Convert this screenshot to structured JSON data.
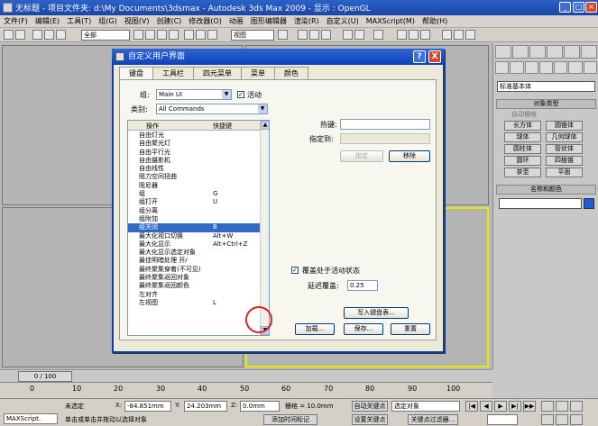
{
  "window": {
    "title": "无标题        - 项目文件夹: d:\\My Documents\\3dsmax        - Autodesk 3ds Max  2009        - 显示 : OpenGL"
  },
  "menu": [
    "文件(F)",
    "编辑(E)",
    "工具(T)",
    "组(G)",
    "视图(V)",
    "创建(C)",
    "修改器(O)",
    "动画",
    "图形编辑器",
    "渲染(R)",
    "自定义(U)",
    "MAXScript(M)",
    "帮助(H)"
  ],
  "toolbar": {
    "selection_set": "全部",
    "view_dropdown": "视图"
  },
  "dialog": {
    "title": "自定义用户界面",
    "help": "?",
    "close": "X",
    "tabs": [
      "键盘",
      "工具栏",
      "四元菜单",
      "菜单",
      "颜色"
    ],
    "group_label": "组:",
    "group_value": "Main UI",
    "active_label": "活动",
    "category_label": "类别:",
    "category_value": "All Commands",
    "col_action": "操作",
    "col_shortcut": "快捷键",
    "actions": [
      {
        "name": "自由灯光",
        "shortcut": ""
      },
      {
        "name": "自由聚光灯",
        "shortcut": ""
      },
      {
        "name": "自由平行光",
        "shortcut": ""
      },
      {
        "name": "自由摄影机",
        "shortcut": ""
      },
      {
        "name": "自由线性",
        "shortcut": ""
      },
      {
        "name": "阻力空间扭曲",
        "shortcut": ""
      },
      {
        "name": "阻尼器",
        "shortcut": ""
      },
      {
        "name": "组",
        "shortcut": "G"
      },
      {
        "name": "组打开",
        "shortcut": "U"
      },
      {
        "name": "组分离",
        "shortcut": ""
      },
      {
        "name": "组附加",
        "shortcut": ""
      },
      {
        "name": "组关闭",
        "shortcut": "B"
      },
      {
        "name": "最大化视口切换",
        "shortcut": "Alt+W"
      },
      {
        "name": "最大化显示",
        "shortcut": "Alt+Ctrl+Z"
      },
      {
        "name": "最大化显示选定对象",
        "shortcut": ""
      },
      {
        "name": "最佳明暗处理 开/",
        "shortcut": ""
      },
      {
        "name": "最终聚集穿着(不可见)",
        "shortcut": ""
      },
      {
        "name": "最终聚集返回对象",
        "shortcut": ""
      },
      {
        "name": "最终聚集返回颜色",
        "shortcut": ""
      },
      {
        "name": "左对齐",
        "shortcut": ""
      },
      {
        "name": "左视图",
        "shortcut": "L"
      }
    ],
    "selected_index": 11,
    "hotkey_label": "热键:",
    "assigned_label": "指定到:",
    "assign_button": "指定",
    "remove_button": "移除",
    "overlay_label": "覆盖处于活动状态",
    "delay_label": "延迟覆盖:",
    "delay_value": "0.25",
    "write_button": "写入键盘表...",
    "load_button": "加载...",
    "save_button": "保存...",
    "reset_button": "重置"
  },
  "command_panel": {
    "dropdown": "标准基本体",
    "rollout_type": "对象类型",
    "autogrid": "自动栅格",
    "objects": [
      "长方体",
      "圆锥体",
      "球体",
      "几何球体",
      "圆柱体",
      "管状体",
      "圆环",
      "四棱锥",
      "茶壶",
      "平面"
    ],
    "rollout_name": "名称和颜色",
    "object_color": "#1c5cd8"
  },
  "timeline": {
    "slider": "0 / 100",
    "ticks": [
      "0",
      "10",
      "20",
      "30",
      "40",
      "50",
      "60",
      "70",
      "80",
      "90",
      "100"
    ]
  },
  "status": {
    "maxscript": "MAXScript.",
    "selection": "未选定",
    "x_label": "X:",
    "x_value": "-84.851mm",
    "y_label": "Y:",
    "y_value": "24.203mm",
    "z_label": "Z:",
    "z_value": "0.0mm",
    "grid": "栅格 = 10.0mm",
    "prompt": "单击或单击并拖动以选择对象",
    "add_time_tag": "添加时间标记",
    "auto_key": "自动关键点",
    "selected_obj": "选定对象",
    "set_key": "设置关键点",
    "key_filter": "关键点过滤器..."
  }
}
